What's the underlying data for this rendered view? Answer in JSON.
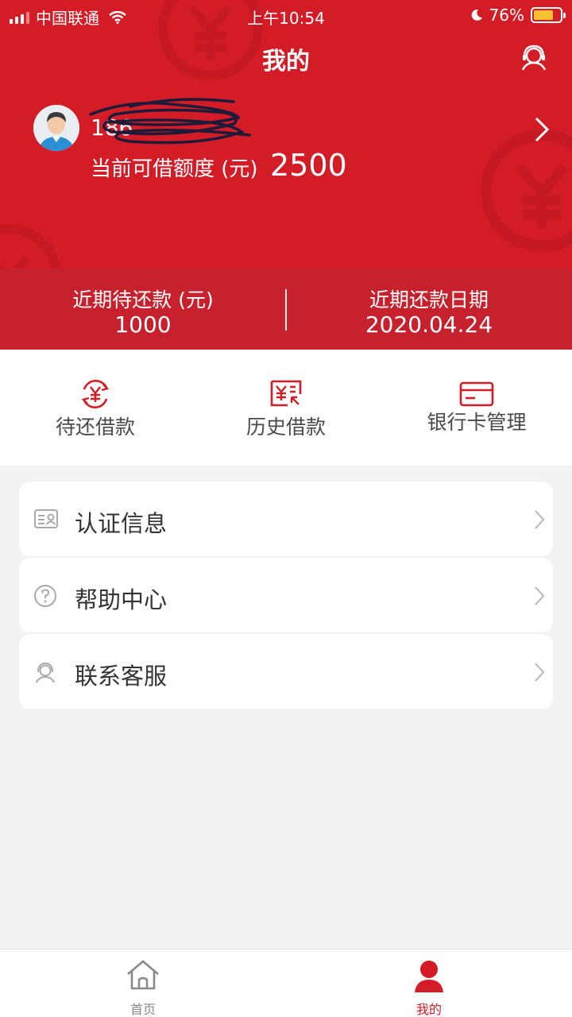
{
  "status_bar": {
    "carrier": "中国联通",
    "time": "上午10:54",
    "battery_percent": "76%",
    "battery_level": 0.76
  },
  "header": {
    "title": "我的",
    "phone": "186",
    "credit_label": "当前可借额度 (元)",
    "credit_value": "2500",
    "brand_color": "#d41c26"
  },
  "summary": {
    "repay_amount_label": "近期待还款 (元)",
    "repay_amount_value": "1000",
    "repay_date_label": "近期还款日期",
    "repay_date_value": "2020.04.24"
  },
  "quick_actions": [
    {
      "label": "待还借款",
      "icon": "yen-cycle-icon"
    },
    {
      "label": "历史借款",
      "icon": "yen-history-icon"
    },
    {
      "label": "银行卡管理",
      "icon": "bank-card-icon"
    }
  ],
  "menu": [
    {
      "label": "认证信息",
      "icon": "id-card-icon"
    },
    {
      "label": "帮助中心",
      "icon": "question-icon"
    },
    {
      "label": "联系客服",
      "icon": "customer-service-icon"
    }
  ],
  "tabbar": [
    {
      "label": "首页",
      "icon": "home-icon",
      "active": false
    },
    {
      "label": "我的",
      "icon": "user-icon",
      "active": true
    }
  ],
  "colors": {
    "active_tab": "#d41c26",
    "inactive_tab": "#888888"
  }
}
